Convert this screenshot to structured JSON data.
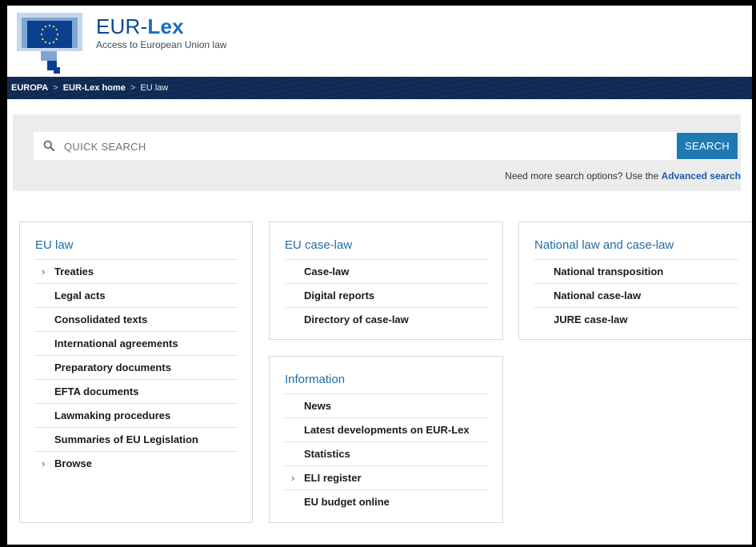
{
  "brand": {
    "name_prefix": "EUR-",
    "name_bold": "Lex",
    "tagline": "Access to European Union law"
  },
  "breadcrumb": {
    "items": [
      "EUROPA",
      "EUR-Lex home",
      "EU law"
    ],
    "separator": ">"
  },
  "search": {
    "placeholder": "QUICK SEARCH",
    "button_label": "SEARCH",
    "hint_text": "Need more search options? Use the ",
    "hint_link": "Advanced search"
  },
  "cards": {
    "eu_law": {
      "title": "EU law",
      "items": [
        "Treaties",
        "Legal acts",
        "Consolidated texts",
        "International agreements",
        "Preparatory documents",
        "EFTA documents",
        "Lawmaking procedures",
        "Summaries of EU Legislation",
        "Browse"
      ]
    },
    "case_law": {
      "title": "EU case-law",
      "items": [
        "Case-law",
        "Digital reports",
        "Directory of case-law"
      ]
    },
    "national": {
      "title": "National law and case-law",
      "items": [
        "National transposition",
        "National case-law",
        "JURE case-law"
      ]
    },
    "information": {
      "title": "Information",
      "items": [
        "News",
        "Latest developments on EUR-Lex",
        "Statistics",
        "ELI register",
        "EU budget online"
      ]
    }
  },
  "colors": {
    "accent": "#1f7ab4",
    "title_blue": "#1f6da6",
    "breadcrumb_bg": "#0f2a52"
  }
}
